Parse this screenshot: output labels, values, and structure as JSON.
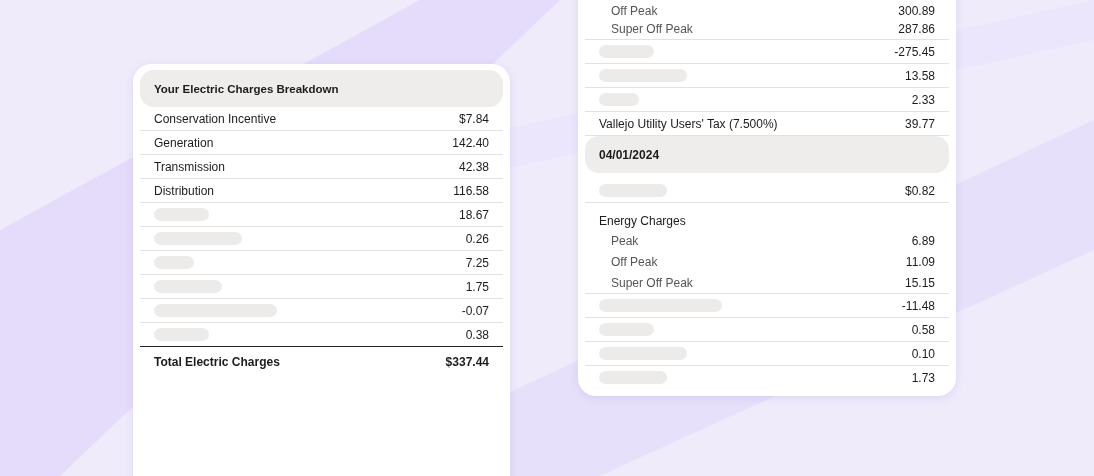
{
  "cards": [
    {
      "header": "Your Electric Charges Breakdown",
      "rows": [
        {
          "kind": "line",
          "label": "Conservation Incentive",
          "value": "$7.84"
        },
        {
          "kind": "line",
          "label": "Generation",
          "value": "142.40"
        },
        {
          "kind": "line",
          "label": "Transmission",
          "value": "42.38"
        },
        {
          "kind": "line",
          "label": "Distribution",
          "value": "116.58"
        },
        {
          "kind": "hidden",
          "value": "18.67"
        },
        {
          "kind": "hidden",
          "value": "0.26"
        },
        {
          "kind": "hidden",
          "value": "7.25"
        },
        {
          "kind": "hidden",
          "value": "1.75"
        },
        {
          "kind": "hidden",
          "value": "-0.07"
        },
        {
          "kind": "hidden",
          "value": "0.38"
        },
        {
          "kind": "total",
          "label": "Total Electric Charges",
          "value": "$337.44"
        }
      ]
    },
    {
      "rows": [
        {
          "kind": "sub",
          "label": "Off Peak",
          "value": "300.89"
        },
        {
          "kind": "sub",
          "label": "Super Off Peak",
          "value": "287.86"
        },
        {
          "kind": "hidden",
          "value": "-275.45"
        },
        {
          "kind": "hidden",
          "value": "13.58"
        },
        {
          "kind": "hidden",
          "value": "2.33"
        },
        {
          "kind": "line",
          "label": "Vallejo Utility Users' Tax (7.500%)",
          "value": "39.77"
        },
        {
          "kind": "section",
          "label": "04/01/2024"
        },
        {
          "kind": "hidden",
          "value": "$0.82"
        },
        {
          "kind": "group",
          "label": "Energy Charges"
        },
        {
          "kind": "sub",
          "label": "Peak",
          "value": "6.89"
        },
        {
          "kind": "sub",
          "label": "Off Peak",
          "value": "11.09"
        },
        {
          "kind": "sub",
          "label": "Super Off Peak",
          "value": "15.15"
        },
        {
          "kind": "hidden",
          "value": "-11.48"
        },
        {
          "kind": "hidden",
          "value": "0.58"
        },
        {
          "kind": "hidden",
          "value": "0.10"
        },
        {
          "kind": "hidden",
          "value": "1.73"
        }
      ]
    }
  ]
}
